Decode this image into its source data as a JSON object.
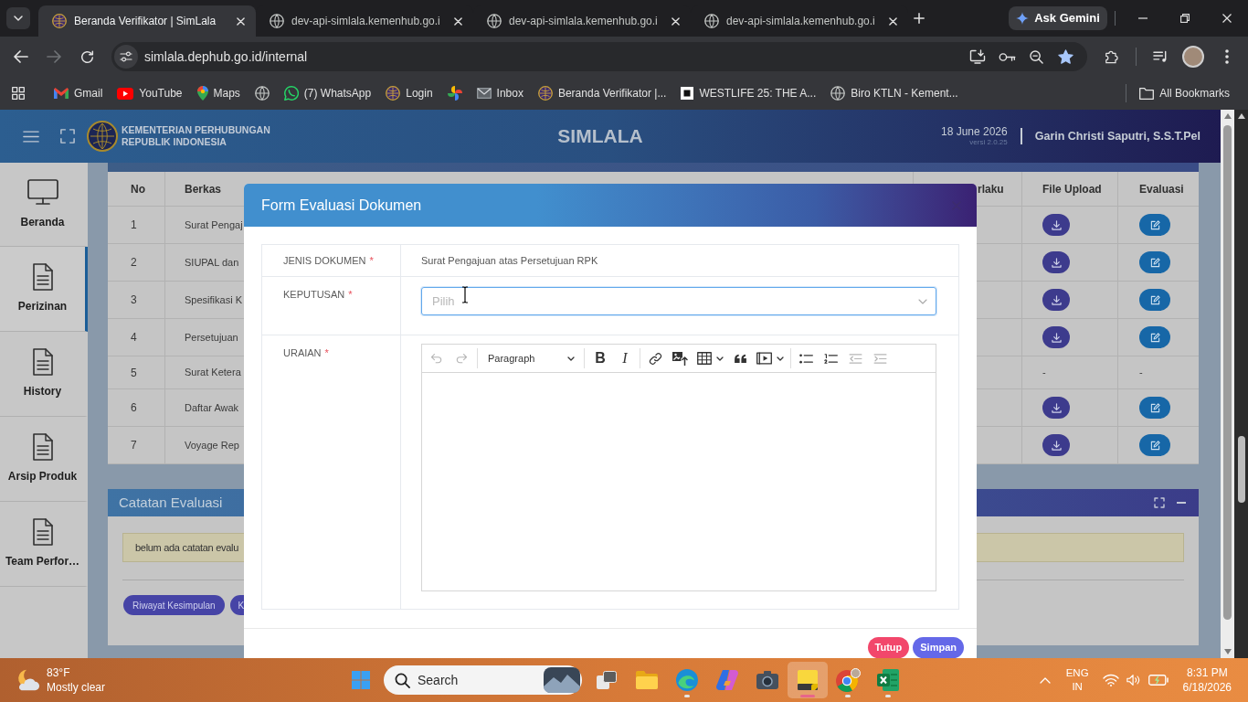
{
  "browser": {
    "tabs": [
      {
        "title": "Beranda Verifikator | SimLala",
        "selected": true
      },
      {
        "title": "dev-api-simlala.kemenhub.go.i",
        "selected": false
      },
      {
        "title": "dev-api-simlala.kemenhub.go.i",
        "selected": false
      },
      {
        "title": "dev-api-simlala.kemenhub.go.i",
        "selected": false
      }
    ],
    "ask_gemini": "Ask Gemini",
    "back_disabled": false,
    "forward_disabled": true,
    "url": "simlala.dephub.go.id/internal",
    "bookmarked": true,
    "bookmarks": [
      {
        "kind": "link",
        "label": "Gmail"
      },
      {
        "kind": "link",
        "label": "YouTube"
      },
      {
        "kind": "link",
        "label": "Maps"
      },
      {
        "kind": "icon"
      },
      {
        "kind": "link",
        "label": "(7) WhatsApp"
      },
      {
        "kind": "link",
        "label": "Login"
      },
      {
        "kind": "icon"
      },
      {
        "kind": "link",
        "label": "Inbox"
      },
      {
        "kind": "link",
        "label": "Beranda Verifikator |..."
      },
      {
        "kind": "link",
        "label": "WESTLIFE 25: THE A..."
      },
      {
        "kind": "link",
        "label": "Biro KTLN - Kement..."
      }
    ],
    "all_bookmarks": "All Bookmarks"
  },
  "app_header": {
    "ministry_line_1": "KEMENTERIAN PERHUBUNGAN",
    "ministry_line_2": "REPUBLIK INDONESIA",
    "app_name": "SIMLALA",
    "date": "18 June 2026",
    "version": "versi 2.0.25",
    "user_name": "Garin Christi Saputri, S.S.T.Pel"
  },
  "sidebar": {
    "items": [
      {
        "label": "Beranda",
        "selected": false
      },
      {
        "label": "Perizinan",
        "selected": true
      },
      {
        "label": "History",
        "selected": false
      },
      {
        "label": "Arsip Produk",
        "selected": false
      },
      {
        "label": "Team Perfor…",
        "selected": false
      }
    ]
  },
  "evaluation_table": {
    "columns": [
      "No",
      "Berkas",
      "rlaku",
      "File Upload",
      "Evaluasi"
    ],
    "rows": [
      {
        "kind": "file",
        "no": "1",
        "document": "Surat Pengaj"
      },
      {
        "kind": "file",
        "no": "2",
        "document": "SIUPAL dan"
      },
      {
        "kind": "file",
        "no": "3",
        "document": "Spesifikasi K"
      },
      {
        "kind": "file",
        "no": "4",
        "document": "Persetujuan"
      },
      {
        "kind": "none",
        "no": "5",
        "document": "Surat Ketera",
        "file_upload": "-",
        "evaluation": "-"
      },
      {
        "kind": "file",
        "no": "6",
        "document": "Daftar Awak"
      },
      {
        "kind": "file",
        "no": "7",
        "document": "Voyage Rep"
      }
    ]
  },
  "notes_card": {
    "title": "Catatan Evaluasi",
    "message": "belum ada catatan evalu",
    "buttons": [
      "Riwayat Kesimpulan",
      "K"
    ]
  },
  "modal": {
    "title": "Form Evaluasi Dokumen",
    "fields": [
      {
        "kind": "text",
        "label": "JENIS DOKUMEN",
        "required_mark": "*",
        "value": "Surat Pengajuan atas Persetujuan RPK"
      },
      {
        "kind": "select",
        "label": "KEPUTUSAN",
        "required_mark": "*",
        "placeholder": "Pilih",
        "focused": true
      },
      {
        "kind": "editor",
        "label": "URAIAN",
        "required_mark": "*",
        "toolbar": {
          "history": [
            {
              "disabled": true
            },
            {
              "disabled": true
            }
          ],
          "block_style": "Paragraph",
          "tools": [
            {
              "label": "B",
              "disabled": false
            },
            {
              "label": "I",
              "disabled": false
            },
            {
              "disabled": false
            },
            {
              "disabled": false
            },
            {
              "disabled": false
            },
            {
              "disabled": false
            },
            {
              "disabled": false
            },
            {
              "disabled": false
            },
            {
              "disabled": false
            },
            {
              "disabled": true
            },
            {
              "disabled": true
            }
          ]
        }
      }
    ],
    "buttons": [
      {
        "kind": "danger",
        "label": "Tutup"
      },
      {
        "kind": "primary",
        "label": "Simpan"
      }
    ]
  },
  "taskbar": {
    "weather": {
      "temperature": "83°F",
      "condition": "Mostly clear"
    },
    "search": {
      "placeholder": "Search"
    },
    "apps": [
      {
        "running": false,
        "selected": false
      },
      {
        "running": false,
        "selected": false
      },
      {
        "running": true,
        "selected": false
      },
      {
        "running": false,
        "selected": false
      },
      {
        "running": false,
        "selected": false
      },
      {
        "running": true,
        "selected": true
      },
      {
        "running": true,
        "selected": false
      },
      {
        "running": true,
        "selected": false
      }
    ],
    "language_code": "ENG",
    "region_code": "IN",
    "time": "8:31 PM",
    "date": "6/18/2026"
  }
}
